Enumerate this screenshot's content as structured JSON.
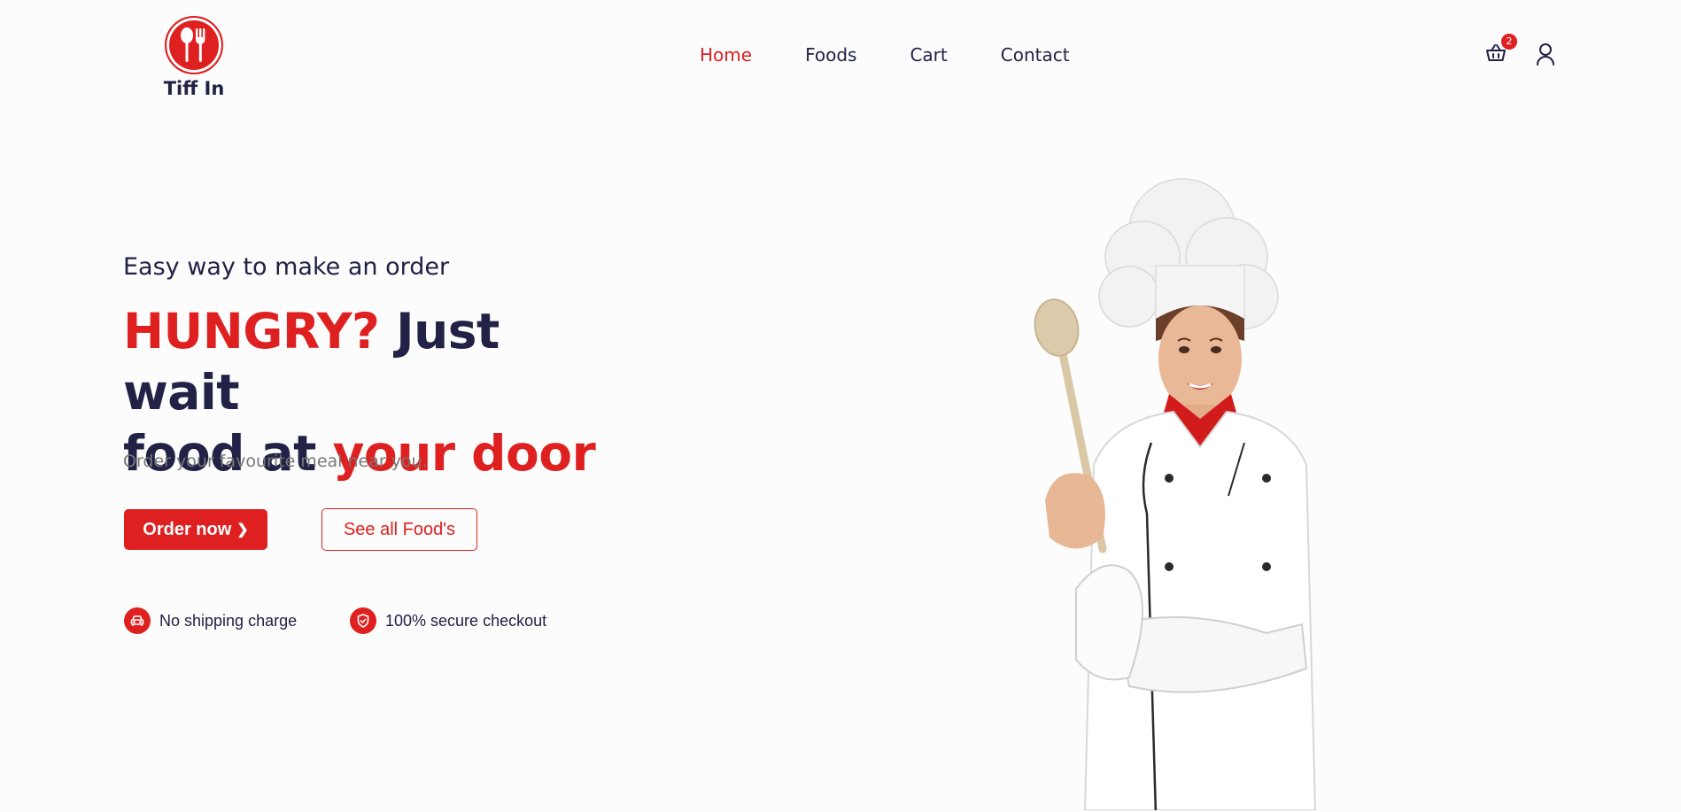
{
  "brand": {
    "name": "Tiff In",
    "icon": "spoon-fork-icon",
    "color": "#df2020"
  },
  "nav": {
    "links": [
      {
        "label": "Home",
        "active": true
      },
      {
        "label": "Foods",
        "active": false
      },
      {
        "label": "Cart",
        "active": false
      },
      {
        "label": "Contact",
        "active": false
      }
    ]
  },
  "header": {
    "cart_icon": "basket-icon",
    "cart_count": "2",
    "user_icon": "user-icon"
  },
  "hero": {
    "subtitle": "Easy way to make an order",
    "headline": {
      "part1": "HUNGRY?",
      "part2": " Just wait",
      "part3": "food at ",
      "part4": "your door"
    },
    "description": "Order your favourite meal near you.",
    "order_button": "Order now",
    "see_all_button": "See all Food's",
    "features": [
      {
        "icon": "car-icon",
        "label": "No shipping charge"
      },
      {
        "icon": "shield-check-icon",
        "label": "100% secure checkout"
      }
    ],
    "image": "chef-with-wooden-spoon"
  },
  "colors": {
    "accent": "#df2020",
    "text": "#212245",
    "muted": "#777777",
    "background": "#fcfcfc"
  }
}
